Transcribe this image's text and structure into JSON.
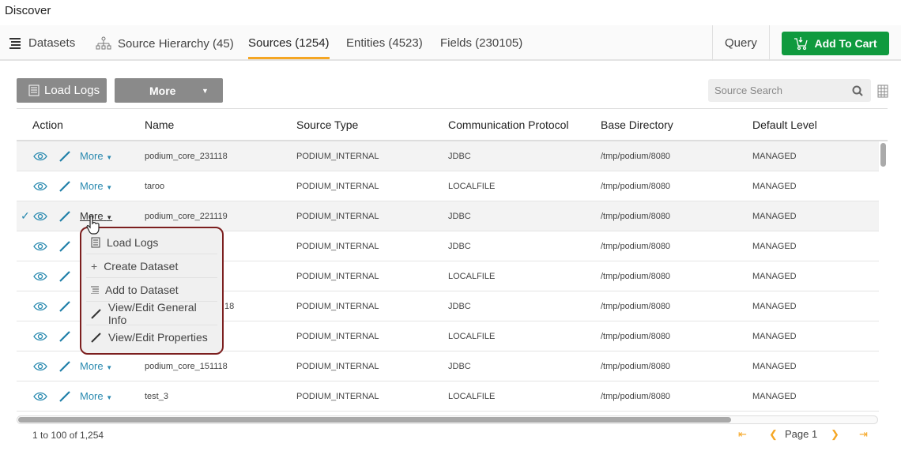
{
  "title": "Discover",
  "nav": {
    "tabs": [
      {
        "label": "Datasets",
        "icon": "menu-lines-icon"
      },
      {
        "label": "Source Hierarchy (45)",
        "icon": "hierarchy-icon"
      },
      {
        "label": "Sources (1254)",
        "active": true
      },
      {
        "label": "Entities (4523)"
      },
      {
        "label": "Fields (230105)"
      }
    ],
    "query": "Query",
    "add_to_cart": "Add To Cart"
  },
  "toolbar": {
    "load_logs": "Load Logs",
    "more": "More",
    "search_placeholder": "Source Search"
  },
  "table": {
    "headers": [
      "Action",
      "Name",
      "Source Type",
      "Communication Protocol",
      "Base Directory",
      "Default Level"
    ],
    "more_label": "More",
    "rows": [
      {
        "name": "podium_core_231118",
        "type": "PODIUM_INTERNAL",
        "protocol": "JDBC",
        "dir": "/tmp/podium/8080",
        "level": "MANAGED"
      },
      {
        "name": "taroo",
        "type": "PODIUM_INTERNAL",
        "protocol": "LOCALFILE",
        "dir": "/tmp/podium/8080",
        "level": "MANAGED"
      },
      {
        "name": "podium_core_221119",
        "type": "PODIUM_INTERNAL",
        "protocol": "JDBC",
        "dir": "/tmp/podium/8080",
        "level": "MANAGED",
        "selected": true
      },
      {
        "name": "",
        "type": "PODIUM_INTERNAL",
        "protocol": "JDBC",
        "dir": "/tmp/podium/8080",
        "level": "MANAGED"
      },
      {
        "name": "",
        "type": "PODIUM_INTERNAL",
        "protocol": "LOCALFILE",
        "dir": "/tmp/podium/8080",
        "level": "MANAGED"
      },
      {
        "name": "18",
        "type": "PODIUM_INTERNAL",
        "protocol": "JDBC",
        "dir": "/tmp/podium/8080",
        "level": "MANAGED"
      },
      {
        "name": "",
        "type": "PODIUM_INTERNAL",
        "protocol": "LOCALFILE",
        "dir": "/tmp/podium/8080",
        "level": "MANAGED"
      },
      {
        "name": "podium_core_151118",
        "type": "PODIUM_INTERNAL",
        "protocol": "JDBC",
        "dir": "/tmp/podium/8080",
        "level": "MANAGED"
      },
      {
        "name": "test_3",
        "type": "PODIUM_INTERNAL",
        "protocol": "LOCALFILE",
        "dir": "/tmp/podium/8080",
        "level": "MANAGED"
      }
    ]
  },
  "menu": {
    "items": [
      "Load Logs",
      "Create Dataset",
      "Add to Dataset",
      "View/Edit General Info",
      "View/Edit Properties"
    ]
  },
  "footer": {
    "range": "1 to 100 of 1,254",
    "page": "Page 1"
  },
  "colors": {
    "accent": "#f5a623",
    "cart": "#0f9a3e",
    "link": "#2a8ab0",
    "menu_border": "#7c1f1f"
  }
}
